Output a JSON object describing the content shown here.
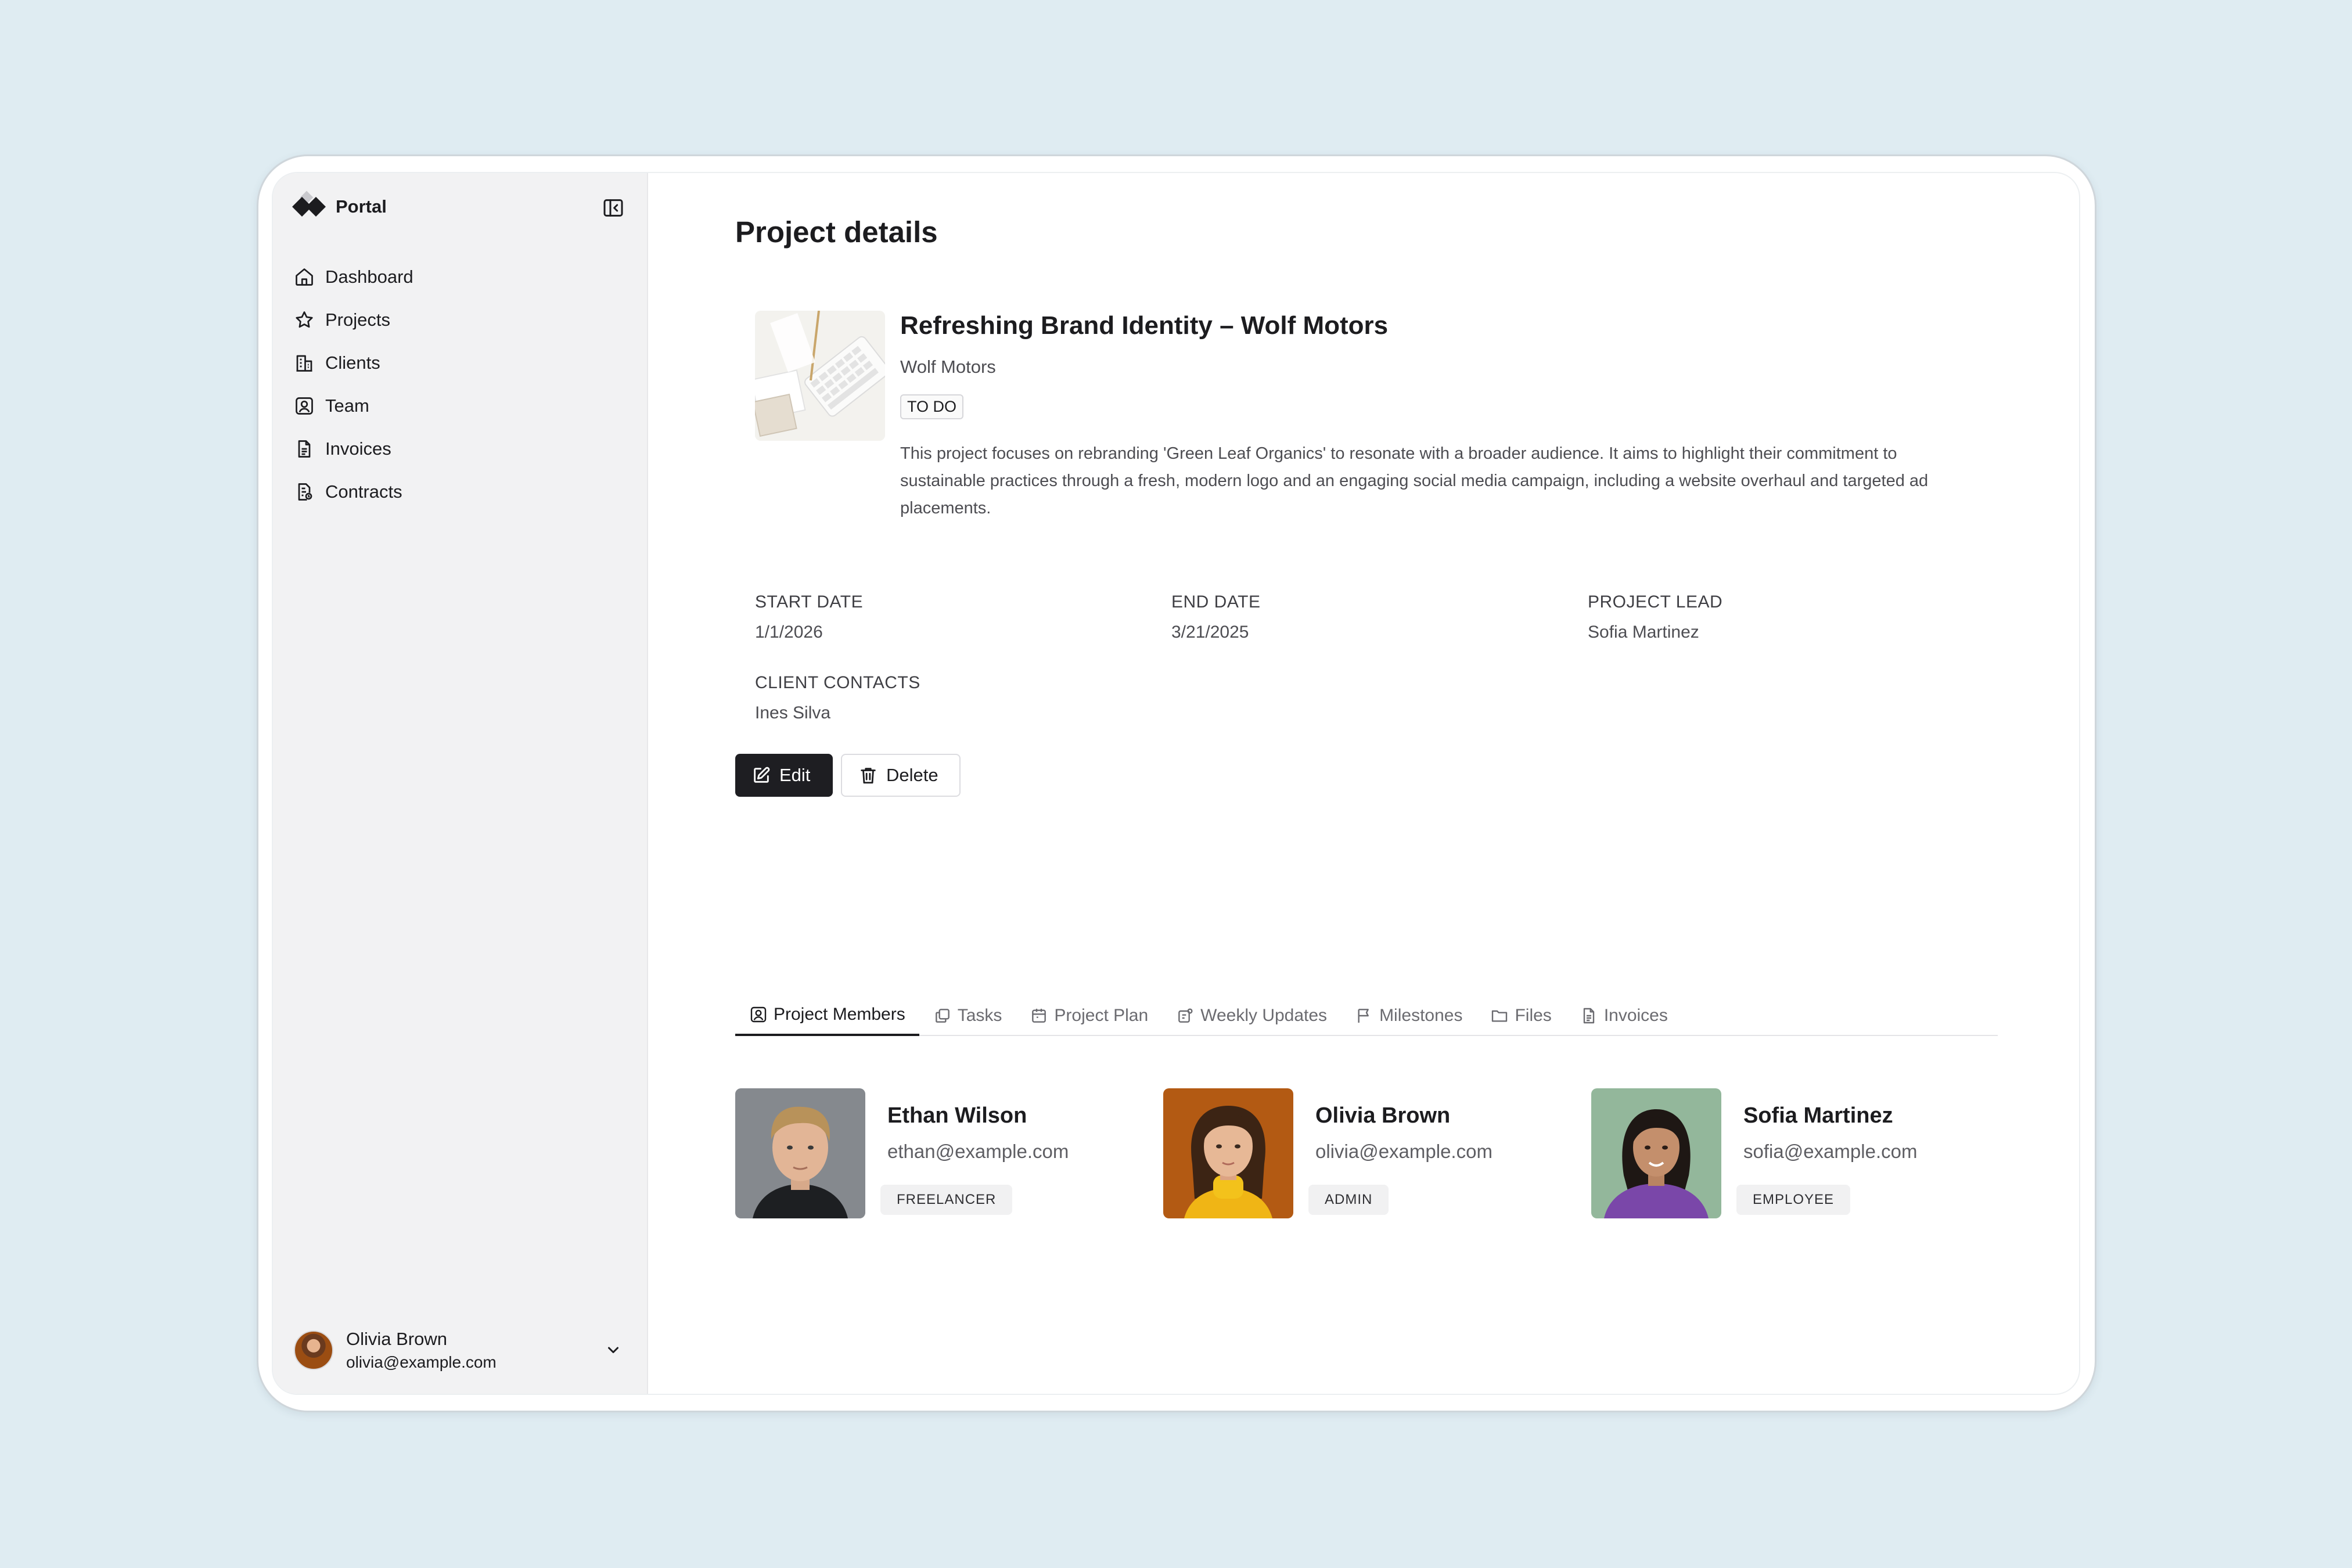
{
  "app": {
    "name": "Portal"
  },
  "sidebar": {
    "items": [
      {
        "label": "Dashboard",
        "icon": "home-icon"
      },
      {
        "label": "Projects",
        "icon": "star-icon"
      },
      {
        "label": "Clients",
        "icon": "building-icon"
      },
      {
        "label": "Team",
        "icon": "user-square-icon"
      },
      {
        "label": "Invoices",
        "icon": "document-icon"
      },
      {
        "label": "Contracts",
        "icon": "contract-icon"
      }
    ],
    "user": {
      "name": "Olivia Brown",
      "email": "olivia@example.com"
    }
  },
  "page": {
    "title": "Project details"
  },
  "project": {
    "title": "Refreshing Brand Identity – Wolf Motors",
    "client": "Wolf Motors",
    "status": "TO DO",
    "description": "This project focuses on rebranding 'Green Leaf Organics' to resonate with a broader audience. It aims to highlight their commitment to sustainable practices through a fresh, modern logo and an engaging social media campaign, including a website overhaul and targeted ad placements.",
    "fields": {
      "start_date": {
        "label": "START DATE",
        "value": "1/1/2026"
      },
      "end_date": {
        "label": "END DATE",
        "value": "3/21/2025"
      },
      "project_lead": {
        "label": "PROJECT LEAD",
        "value": "Sofia Martinez"
      },
      "client_contacts": {
        "label": "CLIENT CONTACTS",
        "value": "Ines Silva"
      }
    }
  },
  "actions": {
    "edit": "Edit",
    "delete": "Delete"
  },
  "tabs": [
    {
      "label": "Project Members",
      "active": true
    },
    {
      "label": "Tasks"
    },
    {
      "label": "Project Plan"
    },
    {
      "label": "Weekly Updates"
    },
    {
      "label": "Milestones"
    },
    {
      "label": "Files"
    },
    {
      "label": "Invoices"
    }
  ],
  "members": [
    {
      "name": "Ethan Wilson",
      "email": "ethan@example.com",
      "role": "FREELANCER"
    },
    {
      "name": "Olivia Brown",
      "email": "olivia@example.com",
      "role": "ADMIN"
    },
    {
      "name": "Sofia Martinez",
      "email": "sofia@example.com",
      "role": "EMPLOYEE"
    }
  ]
}
